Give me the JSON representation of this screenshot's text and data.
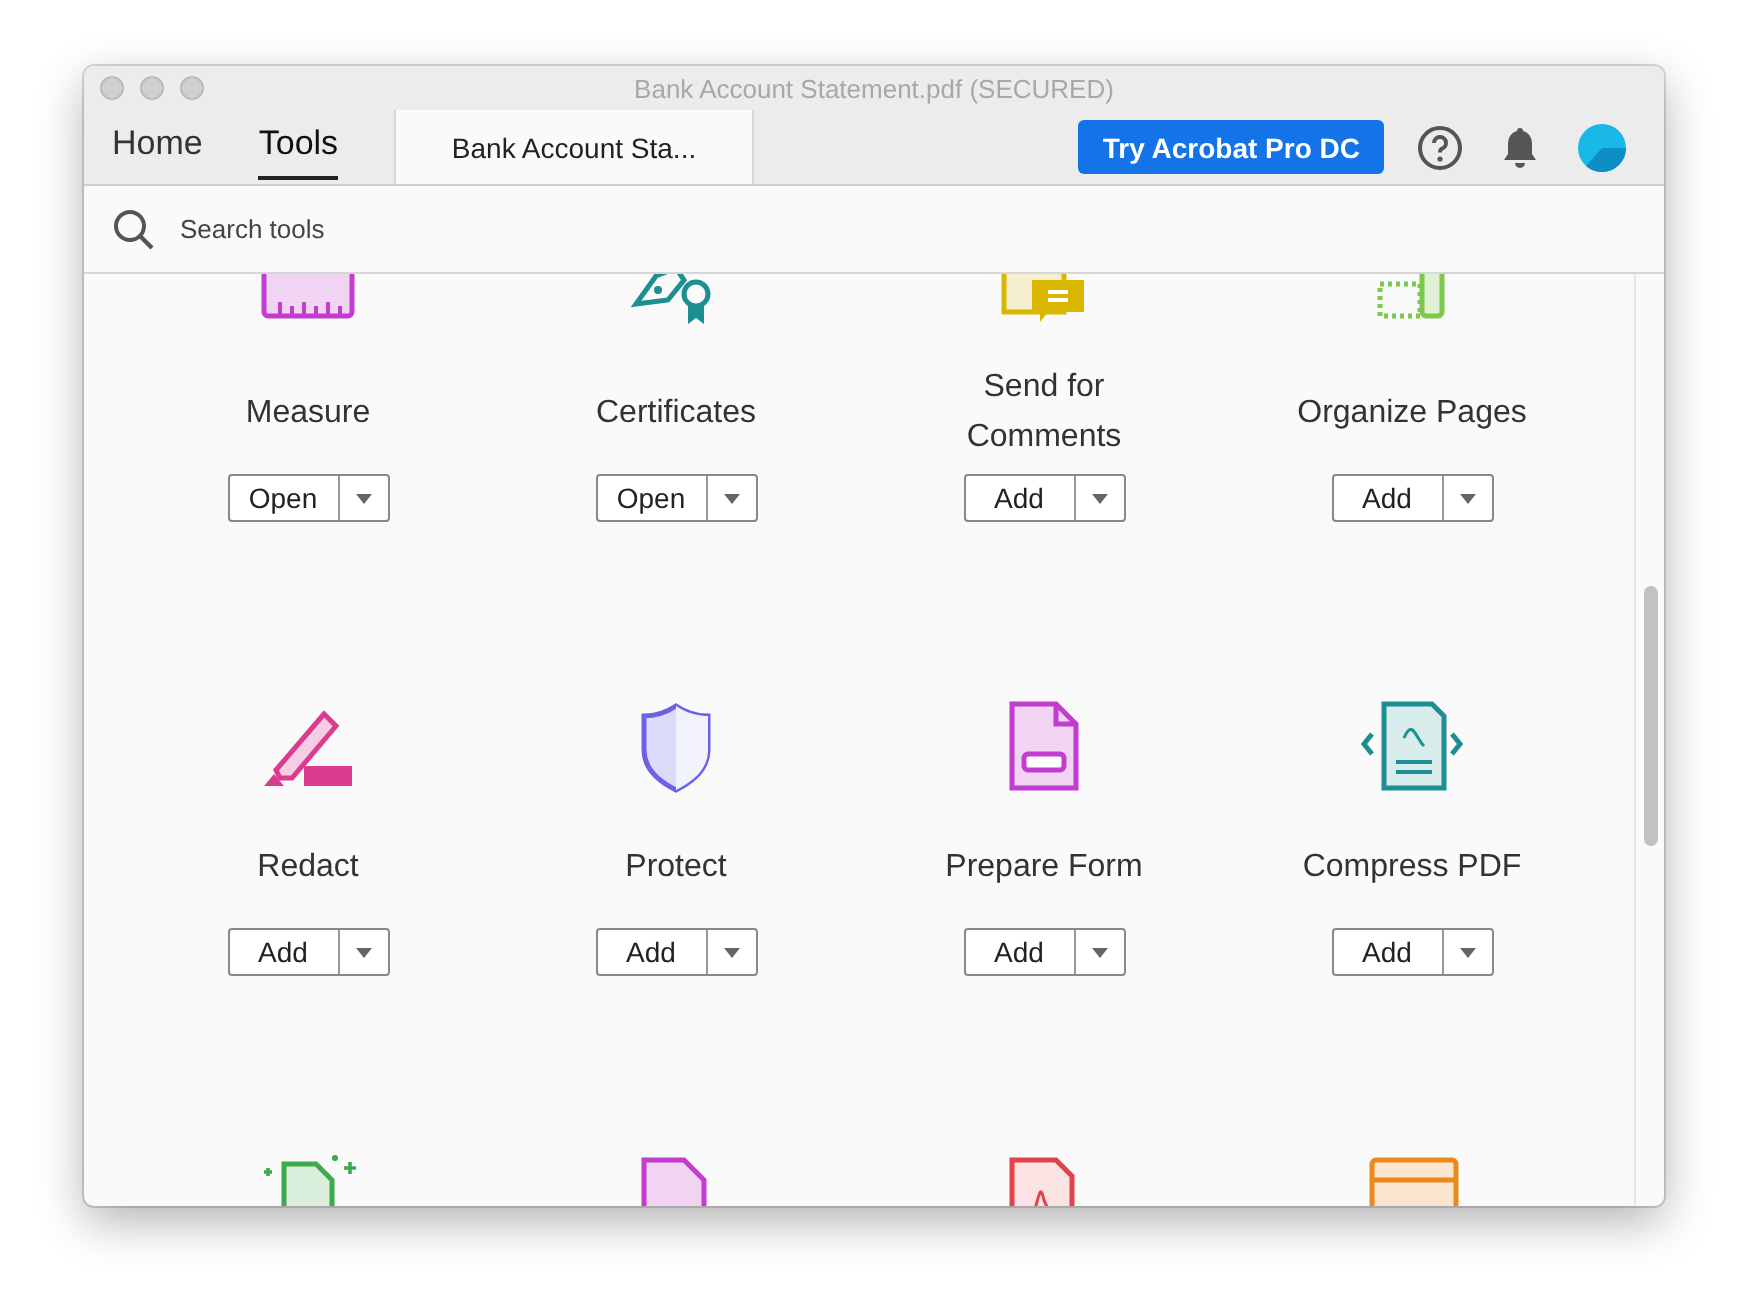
{
  "window": {
    "title": "Bank Account Statement.pdf (SECURED)"
  },
  "tabs": [
    {
      "label": "Home",
      "selected": false
    },
    {
      "label": "Tools",
      "selected": true
    }
  ],
  "document_tab": {
    "label": "Bank Account Sta..."
  },
  "toolbar": {
    "upgrade_button": "Try Acrobat Pro DC"
  },
  "search": {
    "placeholder": "Search tools"
  },
  "tools": [
    {
      "kind": "measure",
      "label": "Measure",
      "button": "Open"
    },
    {
      "kind": "certificates",
      "label": "Certificates",
      "button": "Open"
    },
    {
      "kind": "comments",
      "label": "Send for Comments",
      "button": "Add"
    },
    {
      "kind": "organize",
      "label": "Organize Pages",
      "button": "Add"
    },
    {
      "kind": "redact",
      "label": "Redact",
      "button": "Add"
    },
    {
      "kind": "protect",
      "label": "Protect",
      "button": "Add"
    },
    {
      "kind": "form",
      "label": "Prepare Form",
      "button": "Add"
    },
    {
      "kind": "compress",
      "label": "Compress PDF",
      "button": "Add"
    },
    {
      "kind": "scan"
    },
    {
      "kind": "media"
    },
    {
      "kind": "pdf"
    },
    {
      "kind": "wizard"
    }
  ]
}
